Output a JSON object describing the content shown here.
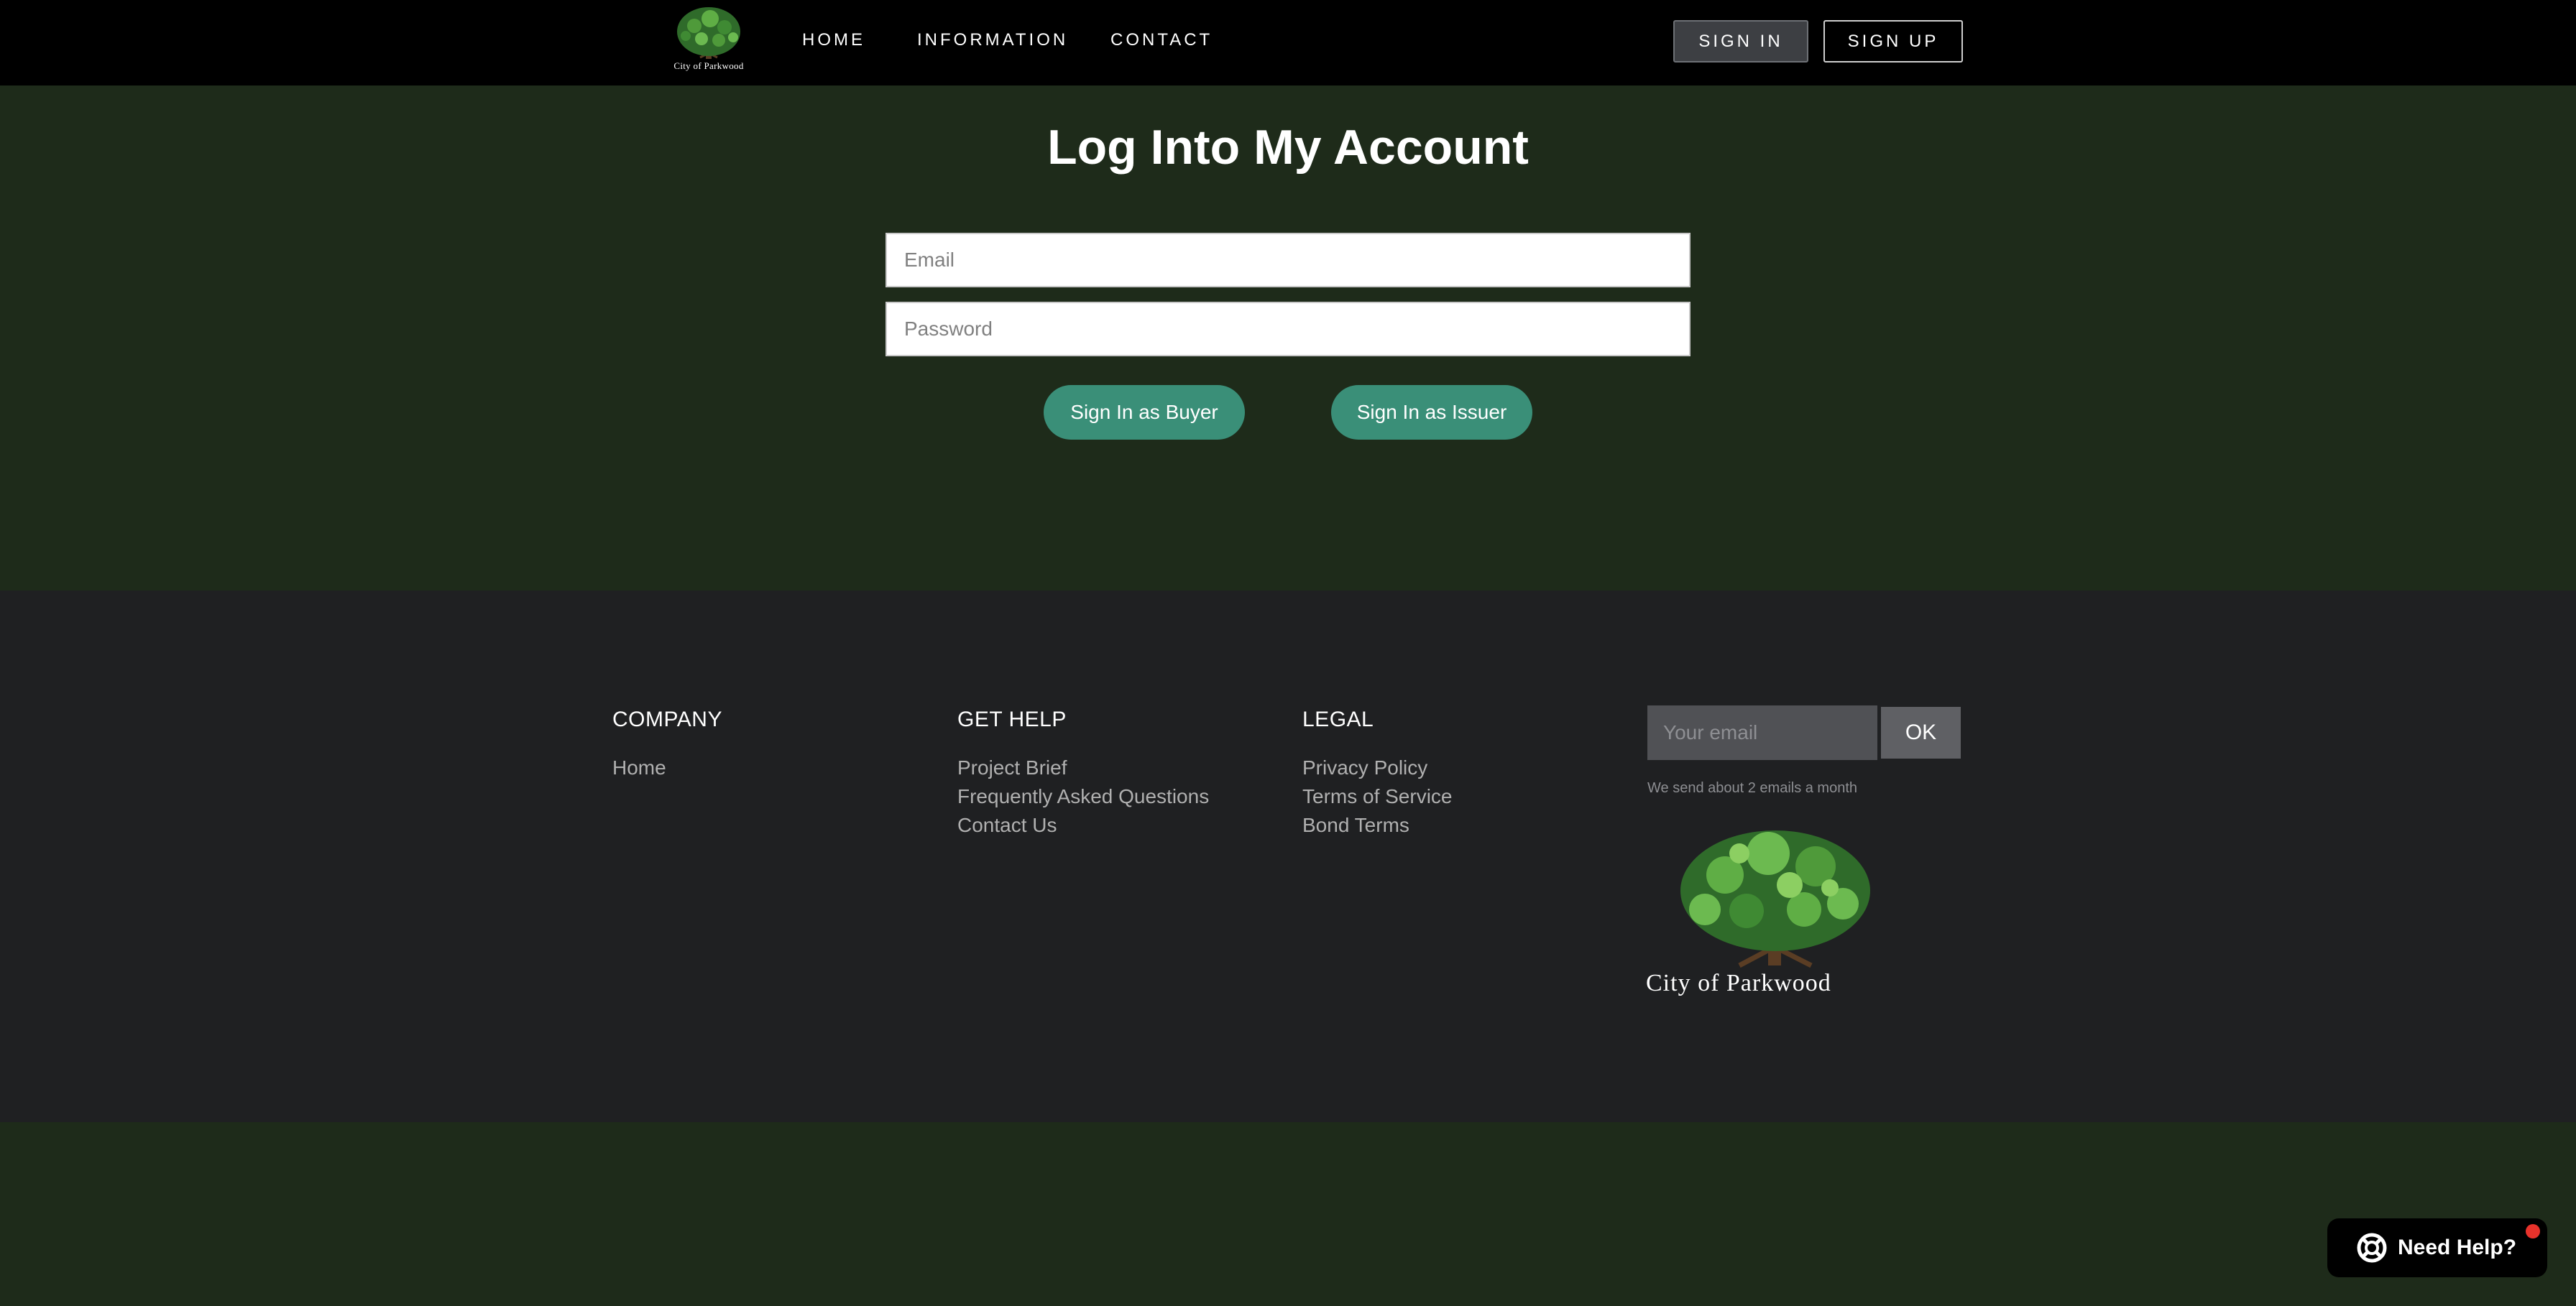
{
  "nav": {
    "logo_text": "City of Parkwood",
    "links": [
      "HOME",
      "INFORMATION",
      "CONTACT"
    ],
    "sign_in": "SIGN IN",
    "sign_up": "SIGN UP"
  },
  "login": {
    "title": "Log Into My Account",
    "email_placeholder": "Email",
    "password_placeholder": "Password",
    "buyer_button": "Sign In as Buyer",
    "issuer_button": "Sign In as Issuer"
  },
  "footer": {
    "company": {
      "title": "COMPANY",
      "links": [
        "Home"
      ]
    },
    "help": {
      "title": "GET HELP",
      "links": [
        "Project Brief",
        "Frequently Asked Questions",
        "Contact Us"
      ]
    },
    "legal": {
      "title": "LEGAL",
      "links": [
        "Privacy Policy",
        "Terms of Service",
        "Bond Terms"
      ]
    },
    "subscribe": {
      "placeholder": "Your email",
      "button": "OK",
      "note": "We send about 2 emails a month"
    },
    "logo_text": "City of Parkwood"
  },
  "help_widget": {
    "label": "Need Help?",
    "icon": "lifebuoy-icon",
    "badge_color": "#e8322b"
  },
  "colors": {
    "page_bg": "#1e2b1a",
    "nav_bg": "#000000",
    "footer_bg": "#1f2022",
    "accent": "#3a8f78"
  }
}
